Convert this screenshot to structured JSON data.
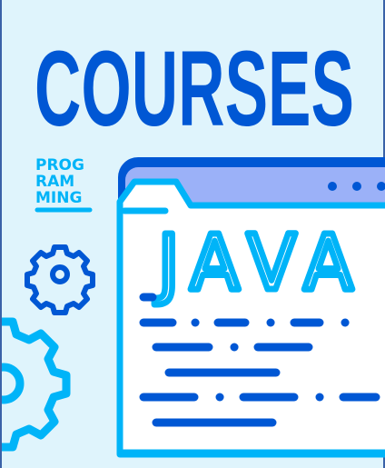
{
  "title": "COURSES",
  "subtitle_lines": [
    "PROG",
    "RAM",
    "MING"
  ],
  "language": "JAVA",
  "colors": {
    "background": "#dff4fc",
    "dark_blue": "#0057d4",
    "cyan": "#00b4f8",
    "lavender": "#9bb1f8",
    "white": "#ffffff"
  },
  "icons": [
    "gear-icon",
    "large-gear-icon",
    "browser-window-icon",
    "folder-icon"
  ]
}
